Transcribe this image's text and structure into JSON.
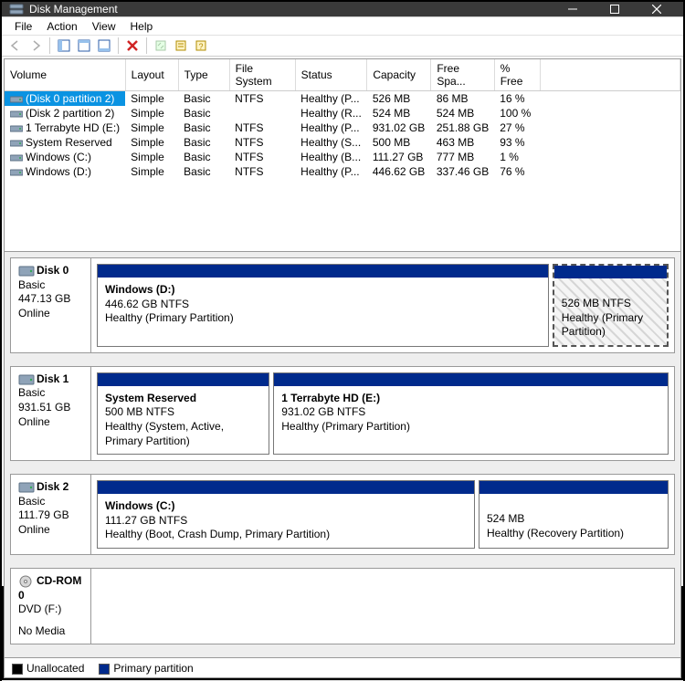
{
  "window": {
    "title": "Disk Management"
  },
  "menu": {
    "file": "File",
    "action": "Action",
    "view": "View",
    "help": "Help"
  },
  "columns": {
    "volume": "Volume",
    "layout": "Layout",
    "type": "Type",
    "fs": "File System",
    "status": "Status",
    "capacity": "Capacity",
    "free": "Free Spa...",
    "pctfree": "% Free"
  },
  "volumes": [
    {
      "name": "(Disk 0 partition 2)",
      "layout": "Simple",
      "type": "Basic",
      "fs": "NTFS",
      "status": "Healthy (P...",
      "capacity": "526 MB",
      "free": "86 MB",
      "pctfree": "16 %",
      "selected": true
    },
    {
      "name": "(Disk 2 partition 2)",
      "layout": "Simple",
      "type": "Basic",
      "fs": "",
      "status": "Healthy (R...",
      "capacity": "524 MB",
      "free": "524 MB",
      "pctfree": "100 %"
    },
    {
      "name": "1 Terrabyte HD (E:)",
      "layout": "Simple",
      "type": "Basic",
      "fs": "NTFS",
      "status": "Healthy (P...",
      "capacity": "931.02 GB",
      "free": "251.88 GB",
      "pctfree": "27 %"
    },
    {
      "name": "System Reserved",
      "layout": "Simple",
      "type": "Basic",
      "fs": "NTFS",
      "status": "Healthy (S...",
      "capacity": "500 MB",
      "free": "463 MB",
      "pctfree": "93 %"
    },
    {
      "name": "Windows (C:)",
      "layout": "Simple",
      "type": "Basic",
      "fs": "NTFS",
      "status": "Healthy (B...",
      "capacity": "111.27 GB",
      "free": "777 MB",
      "pctfree": "1 %"
    },
    {
      "name": "Windows (D:)",
      "layout": "Simple",
      "type": "Basic",
      "fs": "NTFS",
      "status": "Healthy (P...",
      "capacity": "446.62 GB",
      "free": "337.46 GB",
      "pctfree": "76 %"
    }
  ],
  "disks": [
    {
      "name": "Disk 0",
      "kind": "Basic",
      "size": "447.13 GB",
      "state": "Online",
      "parts": [
        {
          "title": "Windows  (D:)",
          "line2": "446.62 GB NTFS",
          "line3": "Healthy (Primary Partition)",
          "flex": 4
        },
        {
          "title": "",
          "line2": "526 MB NTFS",
          "line3": "Healthy (Primary Partition)",
          "flex": 1,
          "hatched": true
        }
      ]
    },
    {
      "name": "Disk 1",
      "kind": "Basic",
      "size": "931.51 GB",
      "state": "Online",
      "parts": [
        {
          "title": "System Reserved",
          "line2": "500 MB NTFS",
          "line3": "Healthy (System, Active, Primary Partition)",
          "flex": 1
        },
        {
          "title": "1 Terrabyte HD  (E:)",
          "line2": "931.02 GB NTFS",
          "line3": "Healthy (Primary Partition)",
          "flex": 2.3
        }
      ]
    },
    {
      "name": "Disk 2",
      "kind": "Basic",
      "size": "111.79 GB",
      "state": "Online",
      "parts": [
        {
          "title": "Windows  (C:)",
          "line2": "111.27 GB NTFS",
          "line3": "Healthy (Boot, Crash Dump, Primary Partition)",
          "flex": 2
        },
        {
          "title": "",
          "line2": "524 MB",
          "line3": "Healthy (Recovery Partition)",
          "flex": 1
        }
      ]
    },
    {
      "name": "CD-ROM 0",
      "kind": "DVD (F:)",
      "size": "",
      "state": "No Media",
      "cd": true,
      "parts": []
    }
  ],
  "legend": {
    "unallocated": "Unallocated",
    "primary": "Primary partition"
  }
}
